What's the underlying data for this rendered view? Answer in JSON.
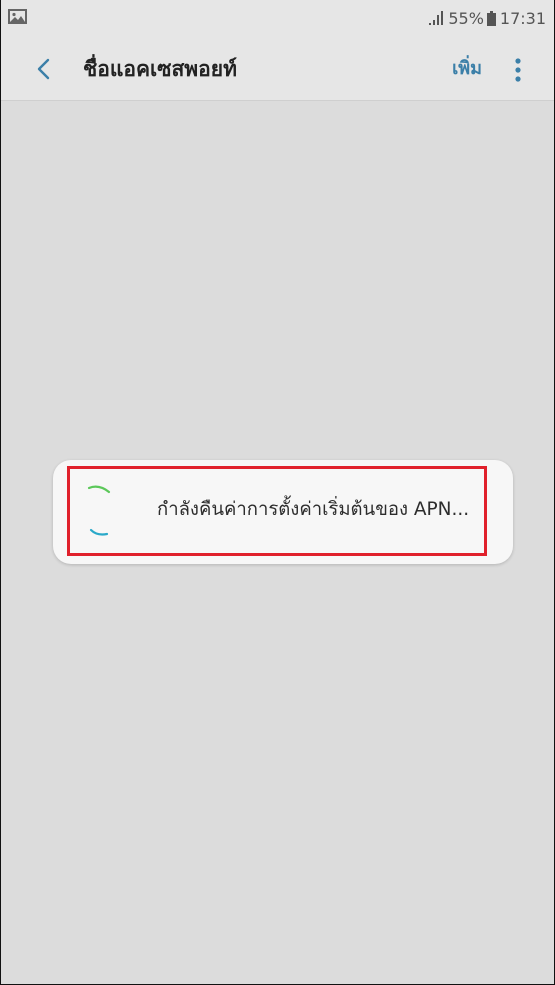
{
  "status_bar": {
    "battery": "55%",
    "time": "17:31",
    "icons": [
      "gallery-icon",
      "signal-icon",
      "battery-icon"
    ]
  },
  "header": {
    "title": "ชื่อแอคเซสพอยท์",
    "add_label": "เพิ่ม",
    "icons": [
      "back-chevron-icon",
      "more-vertical-icon"
    ]
  },
  "dialog": {
    "message": "กำลังคืนค่าการตั้งค่าเริ่มต้นของ APN...",
    "icons": [
      "loading-spinner-icon"
    ],
    "colors": {
      "spinner_top": "#5cc85a",
      "spinner_bottom": "#2aa9c9",
      "highlight": "#e0202b"
    }
  },
  "colors": {
    "background": "#dcdcdc",
    "accent": "#3b7fa8"
  }
}
